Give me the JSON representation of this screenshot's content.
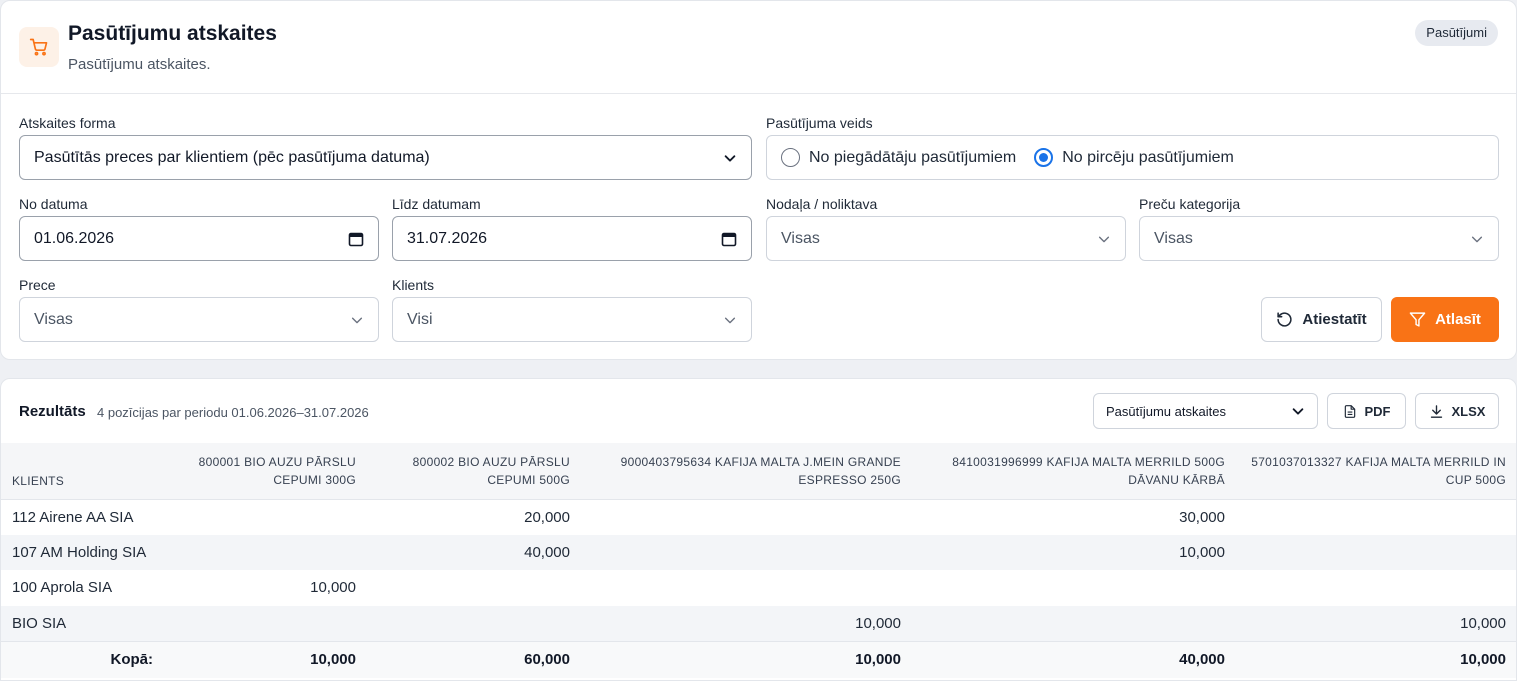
{
  "header": {
    "title": "Pasūtījumu atskaites",
    "subtitle": "Pasūtījumu atskaites.",
    "badge": "Pasūtījumi"
  },
  "filters": {
    "report_form": {
      "label": "Atskaites forma",
      "value": "Pasūtītās preces par klientiem (pēc pasūtījuma datuma)"
    },
    "order_type": {
      "label": "Pasūtījuma veids",
      "options": [
        {
          "label": "No piegādātāju pasūtījumiem",
          "selected": false
        },
        {
          "label": "No pircēju pasūtījumiem",
          "selected": true
        }
      ]
    },
    "date_from": {
      "label": "No datuma",
      "value": "01.06.2026"
    },
    "date_to": {
      "label": "Līdz datumam",
      "value": "31.07.2026"
    },
    "department": {
      "label": "Nodaļa / noliktava",
      "value": "Visas"
    },
    "category": {
      "label": "Preču kategorija",
      "value": "Visas"
    },
    "product": {
      "label": "Prece",
      "value": "Visas"
    },
    "client": {
      "label": "Klients",
      "value": "Visi"
    },
    "reset_label": "Atiestatīt",
    "apply_label": "Atlasīt",
    "accent_color": "#f97316"
  },
  "results": {
    "title": "Rezultāts",
    "subtitle": "4 pozīcijas par periodu 01.06.2026–31.07.2026",
    "report_select": "Pasūtījumu atskaites",
    "pdf_label": "PDF",
    "xlsx_label": "XLSX",
    "table": {
      "columns": [
        "Klients",
        "800001 BIO AUZU PĀRSLU CEPUMI 300G",
        "800002 BIO AUZU PĀRSLU CEPUMI 500G",
        "9000403795634 KAFIJA MALTA J.MEIN GRANDE ESPRESSO 250G",
        "8410031996999 KAFIJA MALTA MERRILD 500G DĀVANU KĀRBĀ",
        "5701037013327 KAFIJA MALTA MERRILD IN CUP 500G"
      ],
      "rows": [
        [
          "112 Airene AA SIA",
          "",
          "20,000",
          "",
          "30,000",
          ""
        ],
        [
          "107 AM Holding SIA",
          "",
          "40,000",
          "",
          "10,000",
          ""
        ],
        [
          "100 Aprola SIA",
          "10,000",
          "",
          "",
          "",
          ""
        ],
        [
          "BIO SIA",
          "",
          "",
          "10,000",
          "",
          "10,000"
        ]
      ],
      "totals": [
        "Kopā:",
        "10,000",
        "60,000",
        "10,000",
        "40,000",
        "10,000"
      ]
    }
  }
}
